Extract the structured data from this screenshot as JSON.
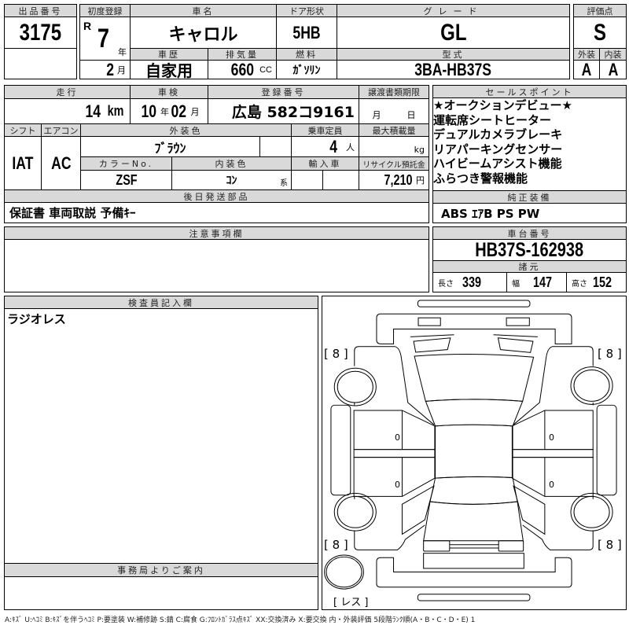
{
  "lot": {
    "label": "出品番号",
    "value": "3175"
  },
  "first_reg": {
    "label": "初度登録",
    "era": "R",
    "year": "7",
    "year_unit": "年",
    "month": "2",
    "month_unit": "月"
  },
  "car_name": {
    "label": "車名",
    "value": "キャロル"
  },
  "door": {
    "label": "ドア形状",
    "value": "5HB"
  },
  "grade": {
    "label": "グレード",
    "value": "GL"
  },
  "history": {
    "label": "車歴",
    "value": "自家用"
  },
  "displacement": {
    "label": "排気量",
    "value": "660",
    "unit": "CC"
  },
  "fuel": {
    "label": "燃料",
    "value": "ｶﾞｿﾘﾝ"
  },
  "model_code": {
    "label": "型式",
    "value": "3BA-HB37S"
  },
  "score": {
    "label": "評価点",
    "value": "S",
    "exterior_label": "外装",
    "exterior": "A",
    "interior_label": "内装",
    "interior": "A"
  },
  "mileage": {
    "label": "走行",
    "value": "14",
    "unit": "km"
  },
  "inspection": {
    "label": "車検",
    "year": "10",
    "year_unit": "年",
    "month": "02",
    "month_unit": "月"
  },
  "plate": {
    "label": "登録番号",
    "value": "広島 582コ9161"
  },
  "transfer_deadline": {
    "label": "譲渡書類期限",
    "month_unit": "月",
    "day_unit": "日"
  },
  "shift": {
    "label": "シフト",
    "value": "IAT"
  },
  "aircon": {
    "label": "エアコン",
    "value": "AC"
  },
  "ext_color": {
    "label": "外装色",
    "value": "ﾌﾞﾗｳﾝ"
  },
  "capacity": {
    "label": "乗車定員",
    "value": "4",
    "unit": "人"
  },
  "max_load": {
    "label": "最大積載量",
    "unit": "kg"
  },
  "color_no": {
    "label": "カラーNo.",
    "value": "ZSF"
  },
  "int_color": {
    "label": "内装色",
    "value": "ｺﾝ",
    "unit": "系"
  },
  "import": {
    "label": "輸入車"
  },
  "recycle": {
    "label": "リサイクル預託金",
    "value": "7,210",
    "unit": "円"
  },
  "later_parts": {
    "label": "後日発送部品",
    "value": "保証書 車両取説 予備ｷｰ"
  },
  "sales_points": {
    "label": "セールスポイント",
    "items": [
      "★オークションデビュー★",
      "運転席シートヒーター",
      "デュアルカメラブレーキ",
      "リアパーキングセンサー",
      "ハイビームアシスト機能",
      "ふらつき警報機能"
    ]
  },
  "equipment": {
    "label": "純正装備",
    "value": "ABS ｴｱB PS PW"
  },
  "notes": {
    "label": "注意事項欄"
  },
  "chassis": {
    "label": "車台番号",
    "value": "HB37S-162938"
  },
  "specs": {
    "label": "諸元",
    "length_label": "長さ",
    "length": "339",
    "width_label": "幅",
    "width": "147",
    "height_label": "高さ",
    "height": "152"
  },
  "inspector": {
    "label": "検査員記入欄",
    "value": "ラジオレス"
  },
  "office": {
    "label": "事務局よりご案内"
  },
  "diagram": {
    "tire_fl": "[ 8 ]",
    "tire_fr": "[ 8 ]",
    "tire_rl": "[ 8 ]",
    "tire_rr": "[ 8 ]",
    "spare": "[ レス ]",
    "door_marks": [
      "0",
      "0",
      "0",
      "0"
    ]
  },
  "footer": "A:ｷｽﾞ U:ﾍｺﾐ B:ｷｽﾞを伴うﾍｺﾐ P:要塗装 W:補修跡 S:錆 C:腐食 G:ﾌﾛﾝﾄｶﾞﾗｽ点ｷｽﾞ XX:交換済み X:要交換 内・外装評価 5段階ﾗﾝｸ順(A・B・C・D・E) 1"
}
